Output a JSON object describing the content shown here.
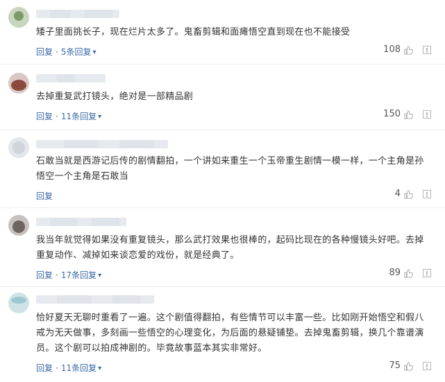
{
  "comments": [
    {
      "text": "矮子里面挑长子，现在烂片太多了。鬼畜剪辑和面瘫悟空直到现在也不能接受",
      "reply_label": "回复",
      "replies_label": "5条回复",
      "likes": "108"
    },
    {
      "text": "去掉重复武打镜头，绝对是一部精品剧",
      "reply_label": "回复",
      "replies_label": "11条回复",
      "likes": "150"
    },
    {
      "text": "石敢当就是西游记后传的剧情翻拍，一个讲如来重生一个玉帝重生剧情一模一样，一个主角是孙悟空一个主角是石敢当",
      "reply_label": "回复",
      "replies_label": "",
      "likes": "4"
    },
    {
      "text": "我当年就觉得如果没有重复镜头，那么武打效果也很棒的，起码比现在的各种慢镜头好吧。去掉重复动作、减掉如来谈恋爱的戏份，就是经典了。",
      "reply_label": "回复",
      "replies_label": "17条回复",
      "likes": "89"
    },
    {
      "text": "恰好夏天无聊时重看了一遍。这个剧值得翻拍，有些情节可以丰富一些。比如刚开始悟空和假八戒为无天做事，多刻画一些悟空的心理变化，为后面的悬疑铺垫。去掉鬼畜剪辑，换几个靠谱演员。这个剧可以拍成神剧的。毕竟故事蓝本其实非常好。",
      "reply_label": "回复",
      "replies_label": "11条回复",
      "likes": "75"
    }
  ],
  "colors": {
    "link": "#3c69a8",
    "text": "#333333",
    "divider": "#eeeeee"
  },
  "icons": {
    "like": "thumbs-up-icon",
    "report": "report-icon",
    "expand": "chevron-down-icon"
  }
}
